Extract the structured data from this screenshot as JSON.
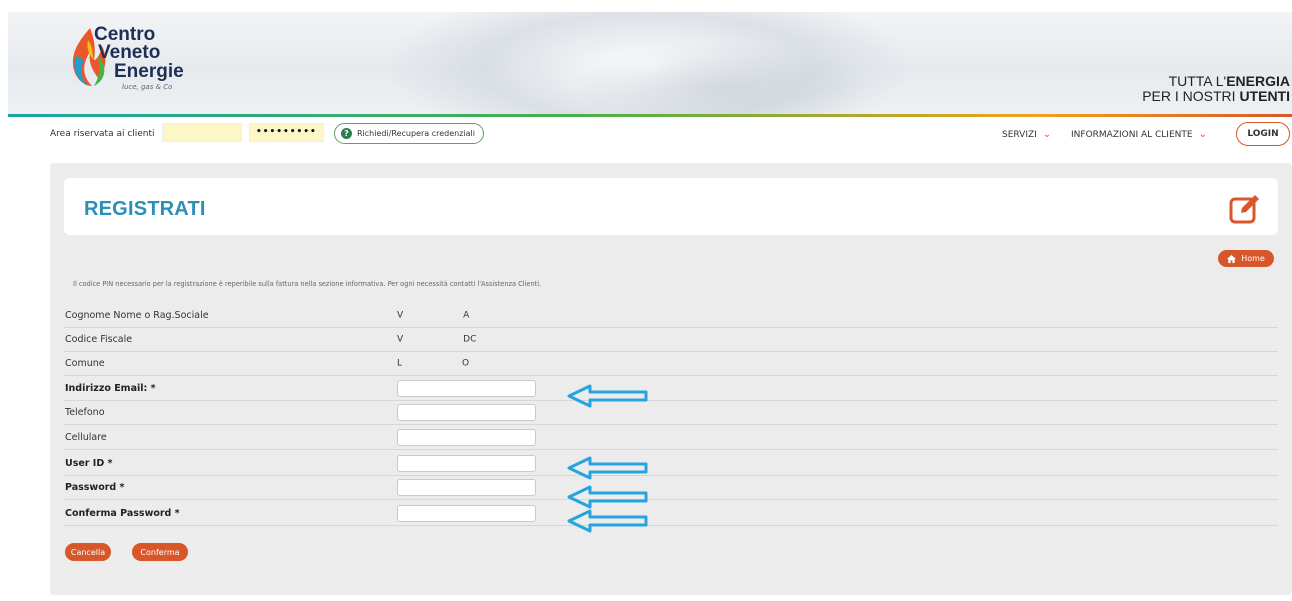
{
  "header": {
    "logo": {
      "line1": "Centro",
      "line2": "Veneto",
      "line3": "Energie",
      "tagline": "luce, gas & Co"
    },
    "slogan": {
      "line1_prefix": "TUTTA L'",
      "line1_bold": "ENERGIA",
      "line2_prefix": "PER I NOSTRI ",
      "line2_bold": "UTENTI"
    }
  },
  "navbar": {
    "area_label": "Area riservata ai clienti",
    "username_value": "",
    "password_value": "•••••••••",
    "recover_label": "Richiedi/Recupera credenziali",
    "menu": [
      {
        "label": "SERVIZI"
      },
      {
        "label": "INFORMAZIONI AL CLIENTE"
      }
    ],
    "login_label": "LOGIN"
  },
  "page": {
    "title": "REGISTRATI",
    "home_label": "Home",
    "info_text": "Il codice PIN necessario per la registrazione è reperibile sulla fattura nella sezione informativa. Per ogni necessità contatti l'Assistenza Clienti.",
    "readonly_fields": [
      {
        "label": "Cognome Nome o Rag.Sociale",
        "value_start": "V",
        "value_end": "A"
      },
      {
        "label": "Codice Fiscale",
        "value_start": "V",
        "value_end": "DC"
      },
      {
        "label": "Comune",
        "value_start": "L",
        "value_end": "O"
      }
    ],
    "input_fields": [
      {
        "label": "Indirizzo Email: *",
        "required": true,
        "value": ""
      },
      {
        "label": "Telefono",
        "required": false,
        "value": ""
      },
      {
        "label": "Cellulare",
        "required": false,
        "value": ""
      },
      {
        "label": "User ID *",
        "required": true,
        "value": ""
      },
      {
        "label": "Password *",
        "required": true,
        "value": ""
      },
      {
        "label": "Conferma Password *",
        "required": true,
        "value": ""
      }
    ],
    "buttons": {
      "cancel": "Cancella",
      "confirm": "Conferma"
    }
  },
  "colors": {
    "accent": "#d8572a",
    "title_blue": "#2b8fb8",
    "annotation_arrow": "#27a3e0",
    "input_highlight": "#fdf7c7"
  }
}
